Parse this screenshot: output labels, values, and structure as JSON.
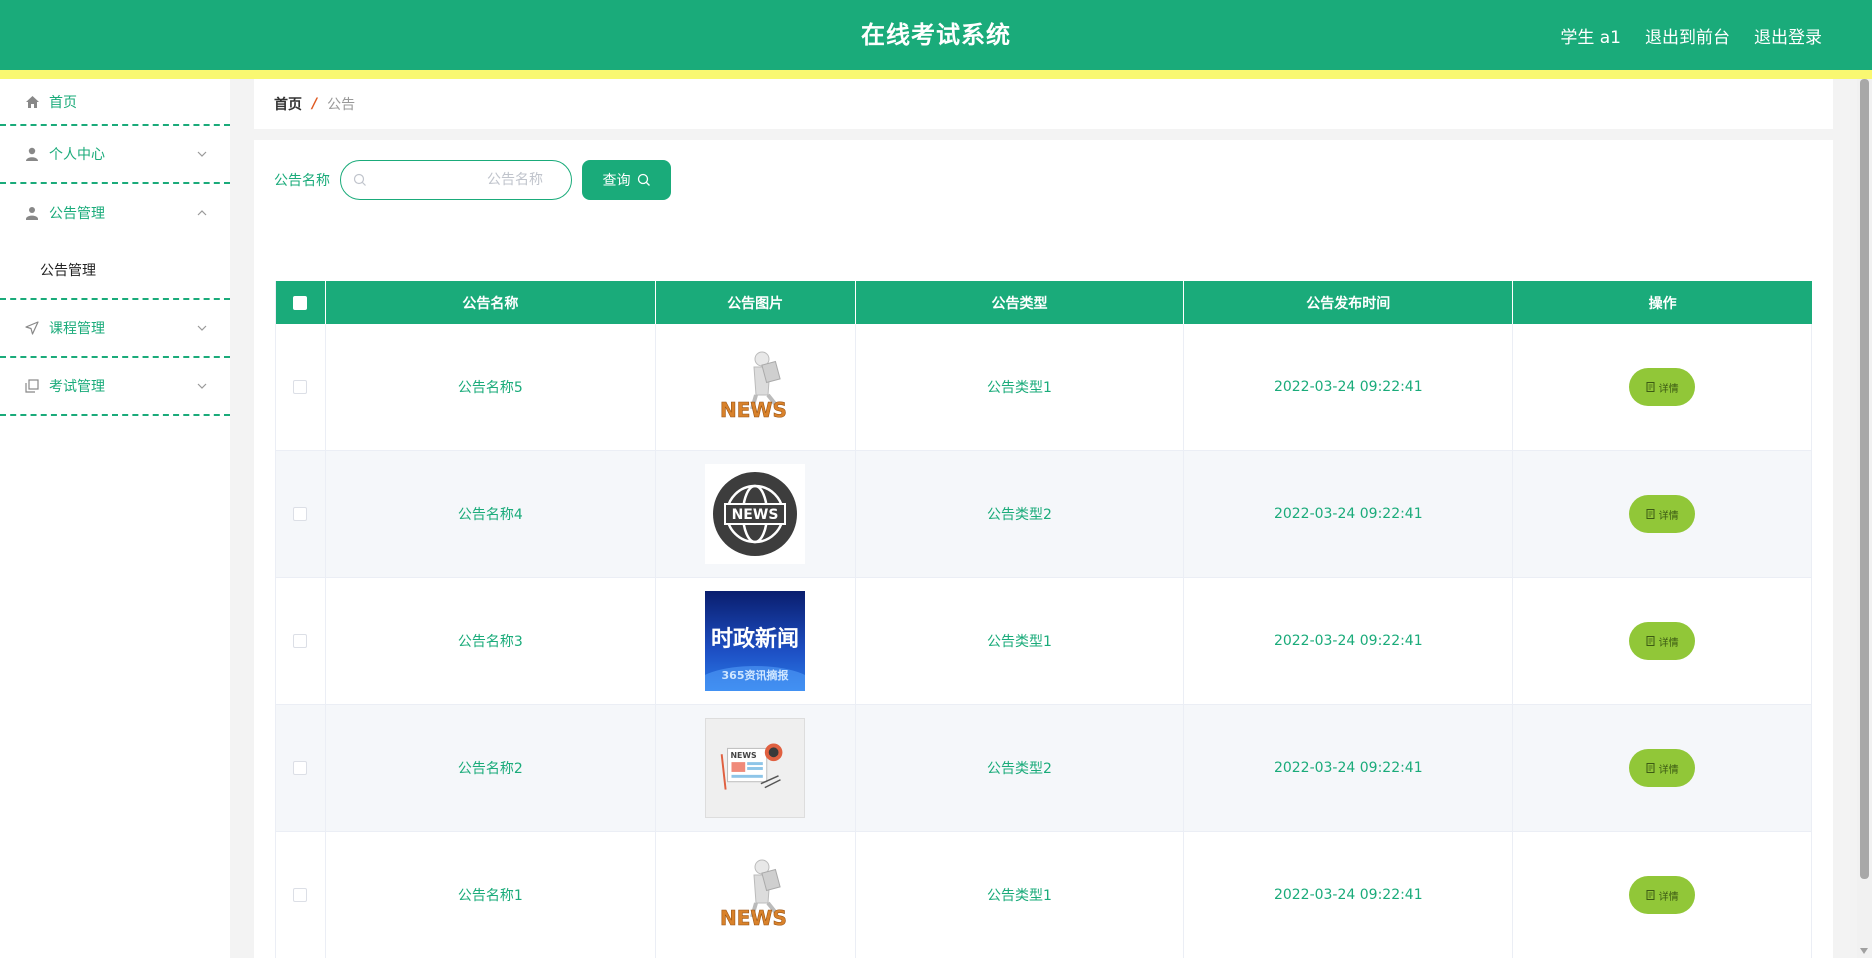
{
  "header": {
    "title": "在线考试系统",
    "user_label": "学生 a1",
    "to_frontend": "退出到前台",
    "logout": "退出登录"
  },
  "sidebar": {
    "items": [
      {
        "label": "首页",
        "icon": "home-icon"
      },
      {
        "label": "个人中心",
        "icon": "user-icon"
      },
      {
        "label": "公告管理",
        "icon": "user-outline-icon",
        "expanded": true,
        "children": [
          {
            "label": "公告管理"
          }
        ]
      },
      {
        "label": "课程管理",
        "icon": "send-icon"
      },
      {
        "label": "考试管理",
        "icon": "copy-icon"
      }
    ]
  },
  "breadcrumb": {
    "home": "首页",
    "separator": "/",
    "current": "公告"
  },
  "search": {
    "label": "公告名称",
    "placeholder": "公告名称",
    "value": "",
    "button_label": "查询"
  },
  "table": {
    "headers": [
      "公告名称",
      "公告图片",
      "公告类型",
      "公告发布时间",
      "操作"
    ],
    "rows": [
      {
        "name": "公告名称5",
        "image": "news-3d-figure",
        "type": "公告类型1",
        "time": "2022-03-24 09:22:41",
        "action": "详情"
      },
      {
        "name": "公告名称4",
        "image": "news-globe",
        "type": "公告类型2",
        "time": "2022-03-24 09:22:41",
        "action": "详情"
      },
      {
        "name": "公告名称3",
        "image": "shizheng-xinwen",
        "type": "公告类型1",
        "time": "2022-03-24 09:22:41",
        "action": "详情"
      },
      {
        "name": "公告名称2",
        "image": "news-flat",
        "type": "公告类型2",
        "time": "2022-03-24 09:22:41",
        "action": "详情"
      },
      {
        "name": "公告名称1",
        "image": "news-3d-figure",
        "type": "公告类型1",
        "time": "2022-03-24 09:22:41",
        "action": "详情"
      }
    ],
    "image_texts": {
      "news": "NEWS",
      "shizheng_title": "时政新闻",
      "shizheng_sub": "365资讯摘报"
    }
  },
  "colors": {
    "primary": "#1aab7a",
    "accent_stripe": "#f9f871",
    "detail_button": "#91c738",
    "breadcrumb_separator": "#e05b22"
  }
}
